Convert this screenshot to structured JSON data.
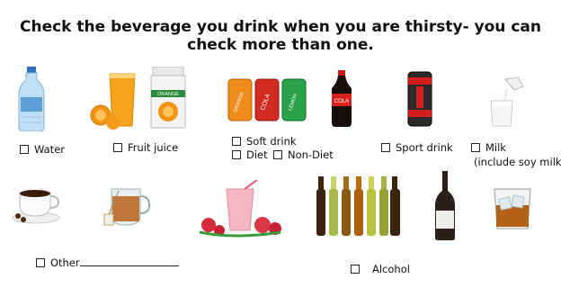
{
  "title": "Check the beverage you drink when you are thirsty- you can check more than one.",
  "options": {
    "water": "Water",
    "fruit_juice": "Fruit juice",
    "soft_drink": "Soft drink",
    "diet": "Diet",
    "non_diet": "Non-Diet",
    "sport_drink": "Sport drink",
    "milk": "Milk",
    "milk_note": "(include soy milk)",
    "other": "Other",
    "alcohol": "Alcohol"
  },
  "image_text": {
    "juice_carton": "ORANGE",
    "can_1": "ORANGE",
    "can_2": "COLA",
    "can_3": "LEMON",
    "cola_bottle": "COLA"
  },
  "colors": {
    "checkbox_border": "#222222",
    "title_text": "#111111"
  }
}
